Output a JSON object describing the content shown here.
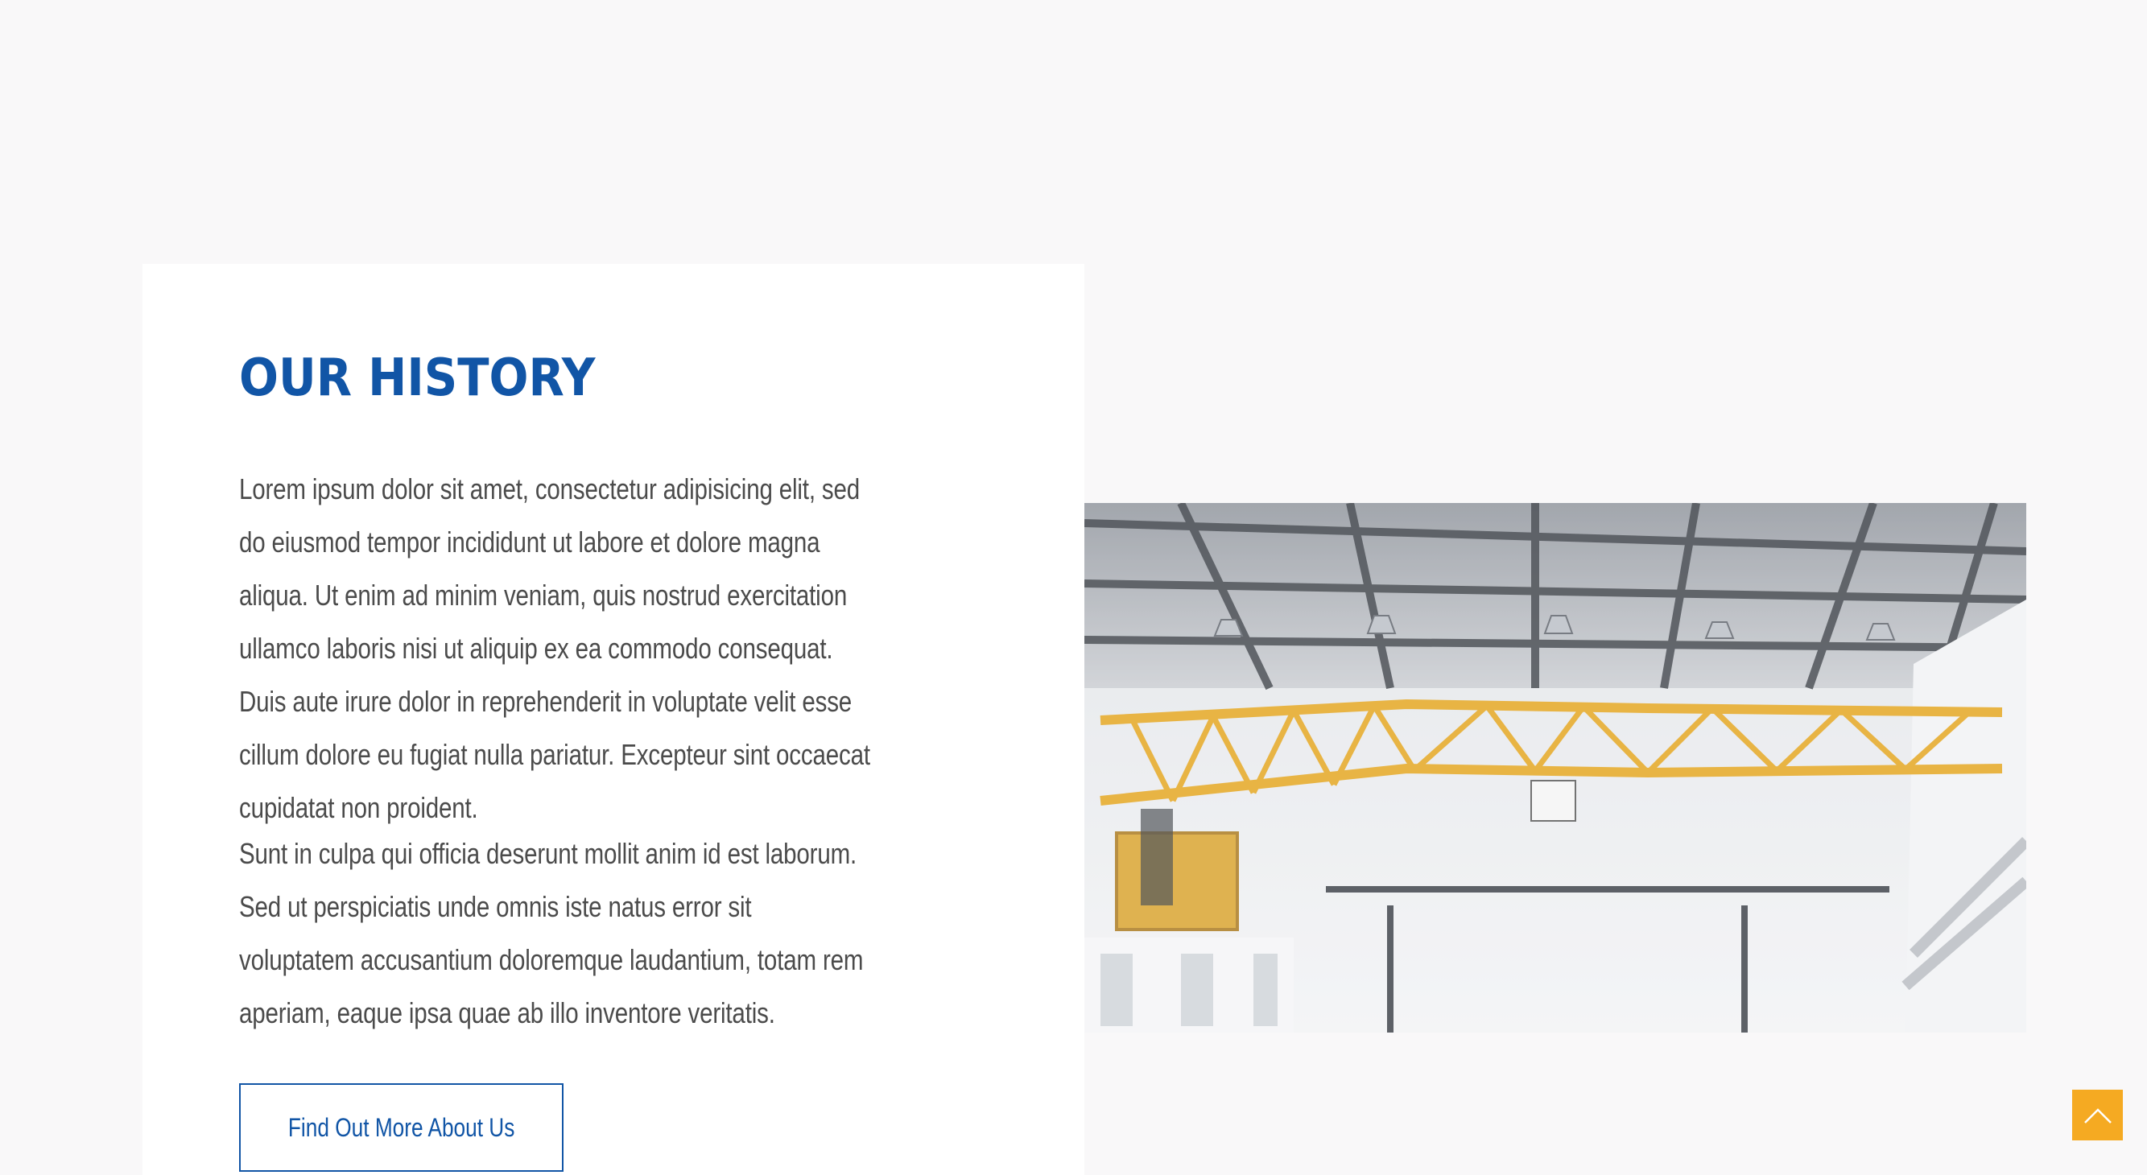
{
  "history": {
    "title": "OUR HISTORY",
    "paragraph_1": "Lorem ipsum dolor sit amet, consectetur adipisicing elit, sed do eiusmod tempor incididunt ut labore et dolore magna aliqua. Ut enim ad minim veniam, quis nostrud exercitation ullamco laboris nisi ut aliquip ex ea commodo consequat. Duis aute irure dolor in reprehenderit in voluptate velit esse cillum dolore eu fugiat nulla pariatur. Excepteur sint occaecat cupidatat non proident.",
    "paragraph_2": "Sunt in culpa qui officia deserunt mollit anim id est laborum. Sed ut perspiciatis unde omnis iste natus error sit voluptatem accusantium doloremque laudantium, totam rem aperiam, eaque ipsa quae ab illo inventore veritatis.",
    "button_label": "Find Out More About Us"
  },
  "image": {
    "subject": "factory-overhead-crane-photo"
  },
  "colors": {
    "accent_blue": "#1155a6",
    "scroll_top_orange": "#f5aa22",
    "page_background": "#f9f8f9",
    "card_background": "#ffffff"
  },
  "icons": {
    "scroll_top": "chevron-up-icon"
  }
}
